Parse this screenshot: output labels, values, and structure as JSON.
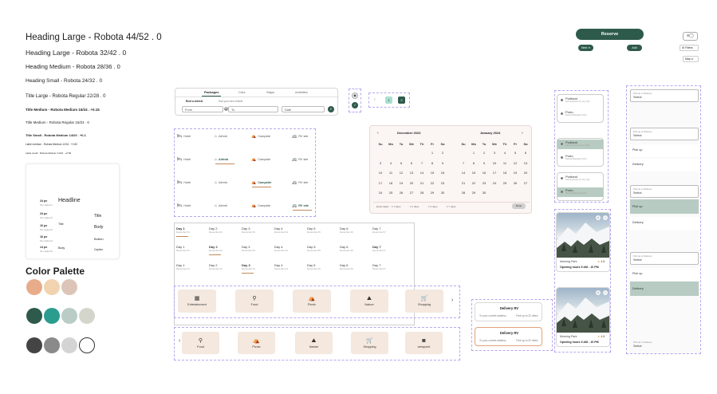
{
  "typography": {
    "h1": "Heading Large - Robota 44/52 . 0",
    "h2": "Heading Large - Robota 32/42 . 0",
    "h3": "Heading Medium - Robota 28/36 . 0",
    "h4": "Heading Small - Robota 24/32 . 0",
    "h5": "Title Large - Robota Regular 22/28 . 0",
    "h6": "Title Medium - Robota Medium 16/24 . +0.15",
    "h7": "Title Medium - Robota Regular 16/24 . 0",
    "h8": "Title Small - Robota Medium 14/20 . +0.1",
    "h9": "Lable medium - Robota Medium 12/16 . +0.50",
    "h10": "Lable small - Robota Medium 11/16 . +0.50"
  },
  "scale_card": {
    "sizes": [
      "24 px",
      "24 px",
      "16 px",
      "16 px",
      "14 px"
    ],
    "subs": [
      "Tex style h1",
      "Tex style h2",
      "Tex style h3",
      "Tex style h4",
      "Tex style h5"
    ],
    "headline": "Headline",
    "title": "Title",
    "body": "Body",
    "title2": "Title",
    "body2": "Body",
    "button": "Button",
    "caption": "Caption"
  },
  "palette": {
    "title": "Color Palette",
    "colors": [
      "#e8ac8a",
      "#f2d3b0",
      "#dcc5b8",
      "#2e5a4c",
      "#2a9d8f",
      "#b9ccc6",
      "#d4d6cc",
      "#444444",
      "#8a8a8a",
      "#d4d4d4",
      "#ffffff"
    ]
  },
  "top_buttons": {
    "reserve": "Reserve",
    "next": "Next",
    "add": "Add",
    "filters": "Filters",
    "map": "Map"
  },
  "search": {
    "tabs": [
      "Packages",
      "Cars",
      "Stays",
      "Activities"
    ],
    "vehicle_options": [
      "Rent a vehicle",
      "Use your own vehicle"
    ],
    "from": "From",
    "to": "To",
    "date": "Date"
  },
  "pager": {
    "pages": [
      "1",
      "2"
    ]
  },
  "categories": {
    "items": [
      "Hotel",
      "Airbnb",
      "Campsite",
      "RV site"
    ]
  },
  "calendar": {
    "months": [
      "December 2023",
      "January 2024"
    ],
    "weekdays": [
      "Su",
      "Mo",
      "Tu",
      "We",
      "Th",
      "Fr",
      "Sa"
    ],
    "dec": [
      "",
      "",
      "",
      "",
      "",
      "1",
      "2",
      "3",
      "4",
      "5",
      "6",
      "7",
      "8",
      "9",
      "10",
      "11",
      "12",
      "13",
      "14",
      "15",
      "16",
      "17",
      "18",
      "19",
      "20",
      "21",
      "22",
      "23",
      "24",
      "25",
      "26",
      "27",
      "28",
      "29",
      "30"
    ],
    "jan": [
      "",
      "1",
      "2",
      "3",
      "4",
      "5",
      "6",
      "7",
      "8",
      "9",
      "10",
      "11",
      "12",
      "13",
      "14",
      "15",
      "16",
      "17",
      "18",
      "19",
      "20",
      "21",
      "22",
      "23",
      "24",
      "25",
      "26",
      "27",
      "28",
      "29",
      "30"
    ],
    "footer": [
      "Exact dates",
      "1 days",
      "2 days",
      "3 days",
      "7 days"
    ],
    "done": "Done"
  },
  "days": {
    "labels": [
      "Day 1",
      "Day 2",
      "Day 3",
      "Day 4",
      "Day 5",
      "Day 6",
      "Day 7"
    ],
    "subs": [
      "December 01",
      "December 02",
      "December 03",
      "December 04",
      "December 05",
      "December 06",
      "December 07"
    ]
  },
  "activities": {
    "row1": [
      "Entertainment",
      "Food",
      "Picnic",
      "Nature",
      "Shopping"
    ],
    "row2": [
      "Food",
      "Picnic",
      "Nature",
      "Shopping",
      "viewpoint"
    ]
  },
  "delivery": {
    "title": "Delivery RV",
    "to_address": "To your current address",
    "free": "Free up to 20 miles"
  },
  "locations": {
    "items": [
      {
        "name": "Portland",
        "addr": "123 Anywhere St. Any City"
      },
      {
        "name": "Porto",
        "addr": "Rua da Boavista, Porto"
      }
    ]
  },
  "parks": {
    "name": "Morning Park",
    "rating": "4.8",
    "hours": "Opening hours 5 AM - 10 PM"
  },
  "pickup": {
    "label": "Pick up or Delivery",
    "select": "Select",
    "pickup": "Pick up",
    "delivery": "Delivery"
  }
}
